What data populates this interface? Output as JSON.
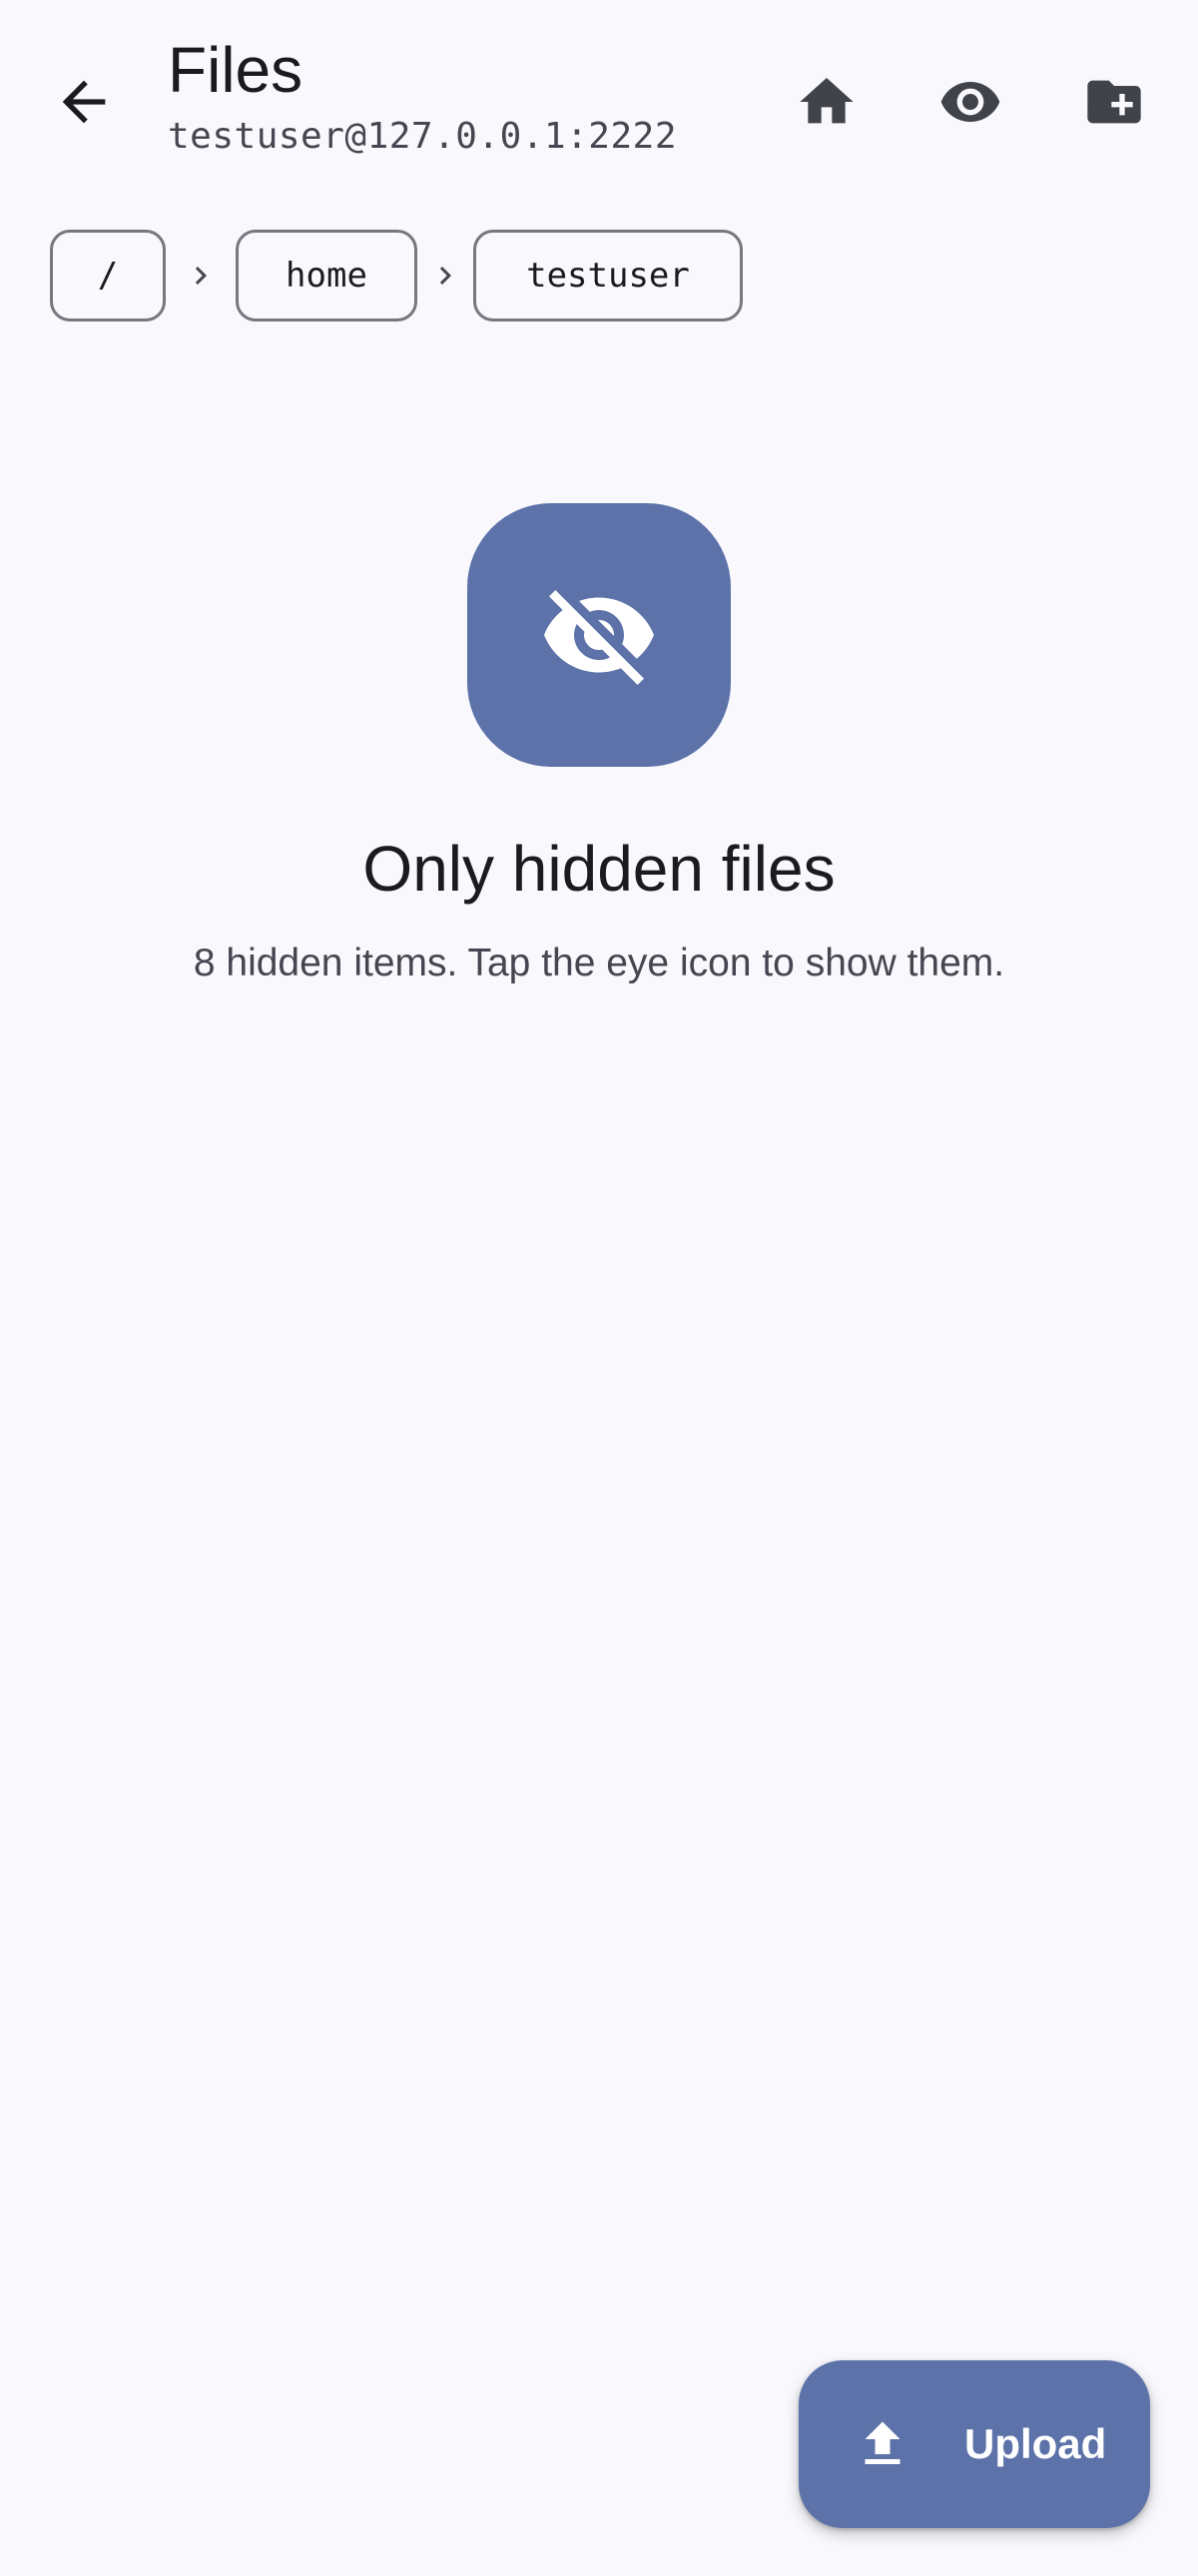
{
  "app_bar": {
    "title": "Files",
    "subtitle": "testuser@127.0.0.1:2222",
    "back_icon": "arrow-back-icon",
    "actions": [
      {
        "name": "home",
        "icon": "home-icon"
      },
      {
        "name": "toggle-hidden",
        "icon": "eye-icon"
      },
      {
        "name": "new-folder",
        "icon": "create-new-folder-icon"
      }
    ]
  },
  "breadcrumb": {
    "items": [
      "/",
      "home",
      "testuser"
    ]
  },
  "empty_state": {
    "icon": "visibility-off-icon",
    "title": "Only hidden files",
    "description": "8 hidden items. Tap the eye icon to show them."
  },
  "fab": {
    "icon": "upload-icon",
    "label": "Upload"
  },
  "colors": {
    "background": "#f8f8fd",
    "primary_container": "#5c72a9",
    "icon": "#41434b",
    "text_primary": "#1b1b1f",
    "text_secondary": "#45464f",
    "outline": "#76777f"
  }
}
